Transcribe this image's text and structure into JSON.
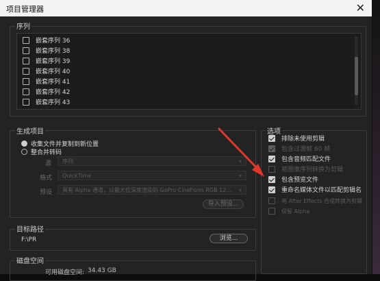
{
  "window": {
    "title": "项目管理器",
    "close_glyph": "✕"
  },
  "sequences": {
    "title": "序列",
    "items": [
      {
        "label": "嵌套序列 36",
        "checked": false
      },
      {
        "label": "嵌套序列 38",
        "checked": false
      },
      {
        "label": "嵌套序列 39",
        "checked": false
      },
      {
        "label": "嵌套序列 40",
        "checked": false
      },
      {
        "label": "嵌套序列 41",
        "checked": false
      },
      {
        "label": "嵌套序列 42",
        "checked": false
      },
      {
        "label": "嵌套序列 43",
        "checked": false
      }
    ]
  },
  "resulting_project": {
    "title": "生成项目",
    "radio_collect": "收集文件并复制到新位置",
    "radio_consolidate": "整合并转码",
    "source_label": "源",
    "source_value": "序列",
    "format_label": "格式",
    "format_value": "QuickTime",
    "preset_label": "预设",
    "preset_value": "具有 Alpha 通道，以最大位深度渲染的 GoPro CineForm RGB 12...",
    "import_preset_button": "导入预设..."
  },
  "options": {
    "title": "选项",
    "items": [
      {
        "label": "排除未使用剪辑",
        "checked": true,
        "enabled": true
      },
      {
        "label": "包含过渡帧",
        "extra": "60 帧",
        "checked": true,
        "enabled": false
      },
      {
        "label": "包含音频匹配文件",
        "checked": true,
        "enabled": true
      },
      {
        "label": "将图像序列转换为剪辑",
        "checked": false,
        "enabled": false
      },
      {
        "label": "包含预览文件",
        "checked": true,
        "enabled": true
      },
      {
        "label": "重命名媒体文件以匹配剪辑名",
        "checked": true,
        "enabled": true
      },
      {
        "label": "将 After Effects 合成转换为剪辑",
        "checked": false,
        "enabled": false
      },
      {
        "label": "保留 Alpha",
        "checked": false,
        "enabled": false
      }
    ]
  },
  "destination": {
    "title": "目标路径",
    "path": "F:\\PR",
    "browse_button": "浏览..."
  },
  "disk_space": {
    "title": "磁盘空间",
    "available_label": "可用磁盘空间:",
    "available_value": "34.43 GB"
  },
  "colors": {
    "arrow": "#e0392b",
    "panel": "#232323"
  }
}
